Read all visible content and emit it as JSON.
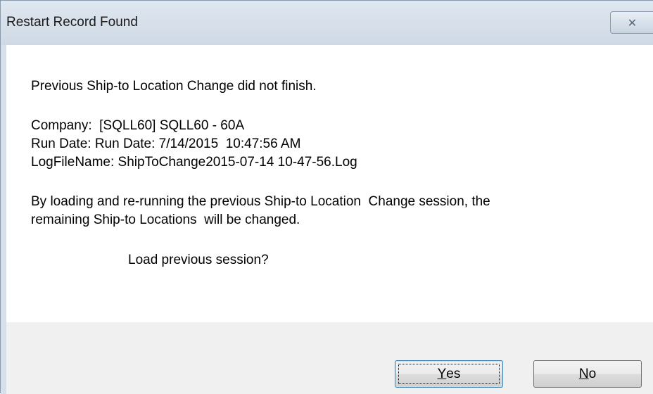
{
  "dialog": {
    "title": "Restart Record Found",
    "close_glyph": "✕",
    "close_icon": "close-icon"
  },
  "message": {
    "line1": "Previous Ship-to Location Change did not finish.",
    "company": "Company:  [SQLL60] SQLL60 - 60A",
    "run_date": "Run Date: Run Date: 7/14/2015  10:47:56 AM",
    "log_file": "LogFileName: ShipToChange2015-07-14 10-47-56.Log",
    "info_line1": "By loading and re-running the previous Ship-to Location  Change session, the",
    "info_line2": "remaining Ship-to Locations  will be changed.",
    "question": "Load previous session?"
  },
  "buttons": {
    "yes_mnemonic": "Y",
    "yes_rest": "es",
    "no_mnemonic": "N",
    "no_rest": "o"
  },
  "colors": {
    "titlebar": "#cfd9e5",
    "footer": "#f0f0f0",
    "default_button_border": "#3c7fb1"
  }
}
